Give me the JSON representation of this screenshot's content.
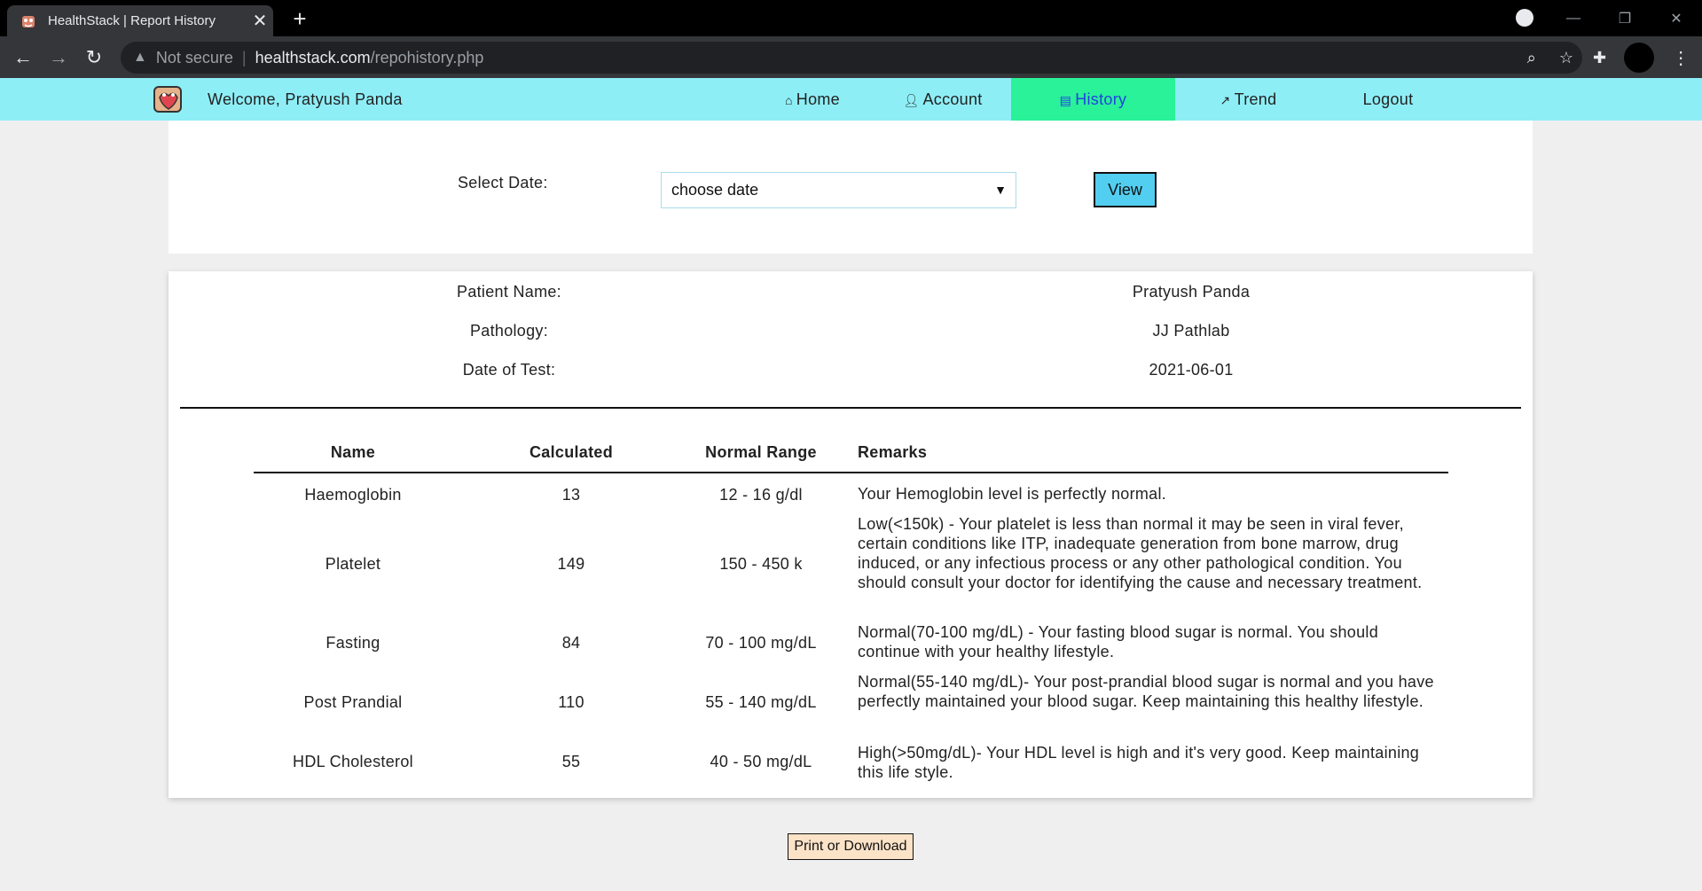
{
  "browser": {
    "tab_title": "HealthStack | Report History",
    "security_label": "Not secure",
    "url_domain": "healthstack.com",
    "url_path": "/repohistory.php"
  },
  "navbar": {
    "welcome": "Welcome, Pratyush Panda",
    "links": [
      {
        "label": "Home",
        "icon": "home-icon"
      },
      {
        "label": "Account",
        "icon": "user-icon"
      },
      {
        "label": "History",
        "icon": "document-icon",
        "active": true
      },
      {
        "label": "Trend",
        "icon": "trend-icon"
      },
      {
        "label": "Logout"
      }
    ],
    "bg_color": "#8eeef6",
    "active_color": "#29f299"
  },
  "date_select": {
    "label": "Select Date:",
    "selected": "choose date",
    "view_label": "View"
  },
  "report": {
    "info": [
      {
        "label": "Patient Name:",
        "value": "Pratyush Panda"
      },
      {
        "label": "Pathology:",
        "value": "JJ Pathlab"
      },
      {
        "label": "Date of Test:",
        "value": "2021-06-01"
      }
    ],
    "headers": {
      "name": "Name",
      "calculated": "Calculated",
      "range": "Normal Range",
      "remarks": "Remarks"
    },
    "rows": [
      {
        "name": "Haemoglobin",
        "calculated": "13",
        "range": "12 - 16 g/dl",
        "remarks": "Your Hemoglobin level is perfectly normal."
      },
      {
        "name": "Platelet",
        "calculated": "149",
        "range": "150 - 450 k",
        "remarks": "Low(<150k) - Your platelet is less than normal it may be seen in viral fever, certain conditions like ITP, inadequate generation from bone marrow, drug induced, or any infectious process or any other pathological condition. You should consult your doctor for identifying the cause and necessary treatment."
      },
      {
        "name": "Fasting",
        "calculated": "84",
        "range": "70 - 100 mg/dL",
        "remarks": "Normal(70-100 mg/dL) - Your fasting blood sugar is normal. You should continue with your healthy lifestyle."
      },
      {
        "name": "Post Prandial",
        "calculated": "110",
        "range": "55 - 140 mg/dL",
        "remarks": "Normal(55-140 mg/dL)- Your post-prandial blood sugar is normal and you have perfectly maintained your blood sugar. Keep maintaining this healthy lifestyle."
      },
      {
        "name": "HDL Cholesterol",
        "calculated": "55",
        "range": "40 - 50 mg/dL",
        "remarks": "High(>50mg/dL)- Your HDL level is high and it's very good. Keep maintaining this life style."
      }
    ]
  },
  "print_label": "Print or Download"
}
